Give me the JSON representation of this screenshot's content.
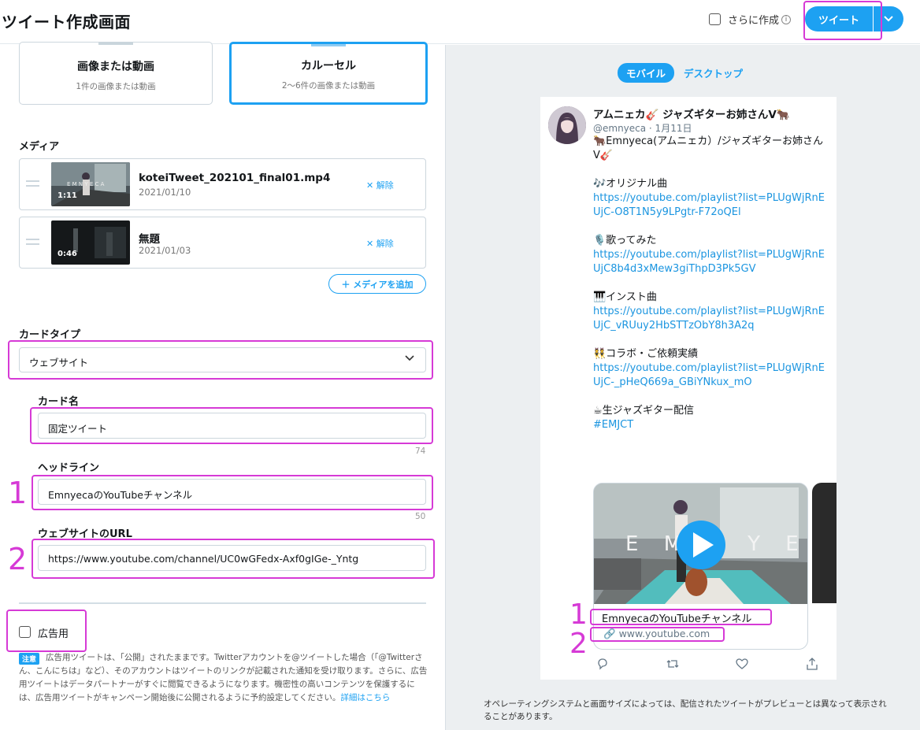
{
  "header": {
    "title": "ツイート作成画面",
    "also_create_label": "さらに作成",
    "info_icon": "i",
    "tweet_button": "ツイート"
  },
  "type_cards": [
    {
      "title": "画像または動画",
      "subtitle": "1件の画像または動画",
      "selected": false
    },
    {
      "title": "カルーセル",
      "subtitle": "2〜6件の画像または動画",
      "selected": true
    }
  ],
  "media": {
    "label": "メディア",
    "items": [
      {
        "name": "koteiTweet_202101_final01.mp4",
        "date": "2021/01/10",
        "duration": "1:11",
        "remove": "解除"
      },
      {
        "name": "無題",
        "date": "2021/01/03",
        "duration": "0:46",
        "remove": "解除"
      }
    ],
    "add_button": "＋ メディアを追加"
  },
  "card_type": {
    "label": "カードタイプ",
    "value": "ウェブサイト"
  },
  "card_name": {
    "label": "カード名",
    "value": "固定ツイート",
    "counter": "74"
  },
  "headline": {
    "label": "ヘッドライン",
    "value": "EmnyecaのYouTubeチャンネル",
    "counter": "50"
  },
  "website_url": {
    "label": "ウェブサイトのURL",
    "value": "https://www.youtube.com/channel/UC0wGFedx-Axf0gIGe-_Yntg"
  },
  "annotations": {
    "one": "1",
    "two": "2"
  },
  "ad": {
    "label": "広告用",
    "badge": "注意",
    "notice": "広告用ツイートは、「公開」されたままです。Twitterアカウントを@ツイートした場合（「@Twitterさん、こんにちは」など）、そのアカウントはツイートのリンクが記載された通知を受け取ります。さらに、広告用ツイートはデータパートナーがすぐに閲覧できるようになります。機密性の高いコンテンツを保護するには、広告用ツイートがキャンペーン開始後に公開されるように予約設定してください。",
    "link": "詳細はこちら"
  },
  "preview": {
    "toggle_mobile": "モバイル",
    "toggle_desktop": "デスクトップ",
    "user_name": "アムニェカ🎸 ジャズギターお姉さんV🐂",
    "handle": "@emnyeca · 1月11日",
    "intro": "🐂Emnyeca(アムニェカ）/ジャズギターお姉さんV🎸",
    "sections": [
      {
        "heading": "🎶オリジナル曲",
        "url": "https://youtube.com/playlist?list=PLUgWjRnEUjC-O8T1N5y9LPgtr-F72oQEl"
      },
      {
        "heading": "🎙️歌ってみた",
        "url": "https://youtube.com/playlist?list=PLUgWjRnEUjC8b4d3xMew3giThpD3Pk5GV"
      },
      {
        "heading": "🎹インスト曲",
        "url": "https://youtube.com/playlist?list=PLUgWjRnEUjC_vRUuy2HbSTTzObY8h3A2q"
      },
      {
        "heading": "👯コラボ・ご依頼実績",
        "url": "https://youtube.com/playlist?list=PLUgWjRnEUjC-_pHeQ669a_GBiYNkux_mO"
      },
      {
        "heading": "☕生ジャズギター配信",
        "url": "#EMJCT"
      }
    ],
    "card_title": "EmnyecaのYouTubeチャンネル",
    "card_domain": "www.youtube.com",
    "footnote": "オペレーティングシステムと画面サイズによっては、配信されたツイートがプレビューとは異なって表示されることがあります。"
  },
  "colors": {
    "accent": "#1da1f2",
    "highlight": "#d63ad6",
    "link": "#1b95e0"
  }
}
